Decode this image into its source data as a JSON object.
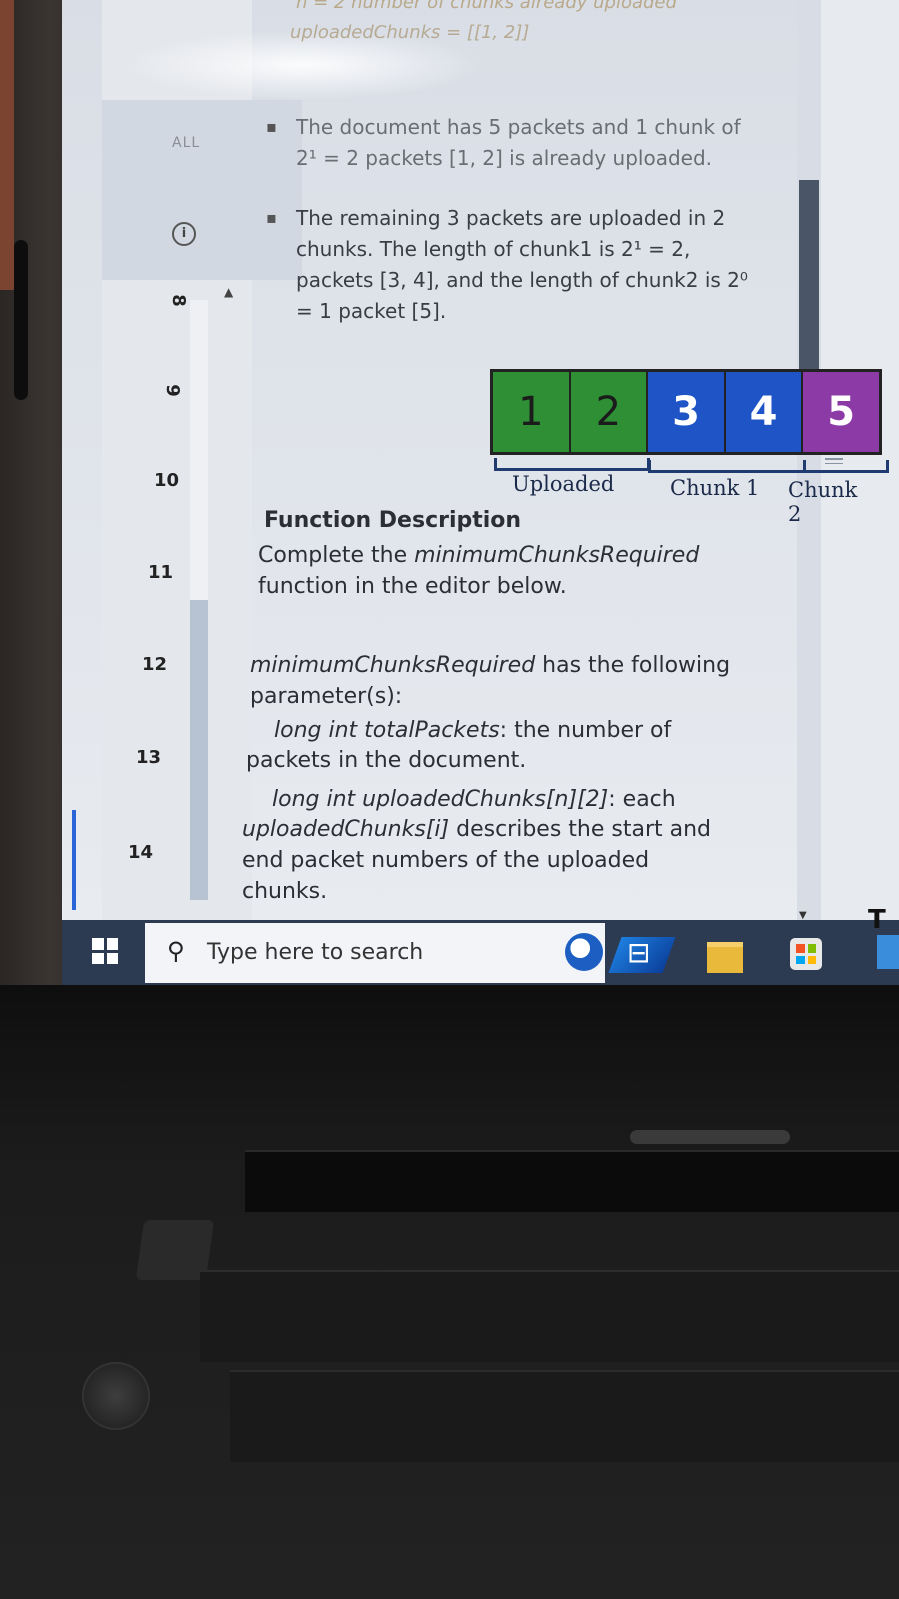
{
  "top_faded": {
    "line1": "n = 2 number of chunks already uploaded",
    "line2": "uploadedChunks = [[1, 2]]"
  },
  "gutter": {
    "all_tab": "ALL",
    "info_icon": "i",
    "line_numbers": [
      "8",
      "9",
      "10",
      "11",
      "12",
      "13",
      "14"
    ]
  },
  "bullets": {
    "b1": "The document has 5 packets and 1 chunk of 2¹ = 2 packets [1, 2] is already uploaded.",
    "b2": "The remaining 3 packets are uploaded in 2 chunks. The length of chunk1 is 2¹ = 2, packets [3, 4], and the length of chunk2 is 2⁰ = 1 packet [5]."
  },
  "diagram": {
    "packets": [
      "1",
      "2",
      "3",
      "4",
      "5"
    ],
    "labels": [
      "Uploaded",
      "Chunk 1",
      "Chunk 2"
    ]
  },
  "description": {
    "heading": "Function Description",
    "line1_pre": "Complete the ",
    "line1_fn": "minimumChunksRequired",
    "line1_post": "function in the editor below.",
    "params_fn": "minimumChunksRequired",
    "params_post": " has the following",
    "params_line2": "parameter(s):",
    "p_total_italic": "long int totalPackets",
    "p_total_rest": ": the number of",
    "p_total_line2": "packets in the document.",
    "p_up_italic": "long int uploadedChunks[n][2]",
    "p_up_rest": ": each",
    "p_up_line2_italic": "uploadedChunks[i]",
    "p_up_line2_rest": " describes the start and",
    "p_up_line3": "end packet numbers of the uploaded",
    "p_up_line4": "chunks."
  },
  "taskbar": {
    "search_placeholder": "Type here to search",
    "right_edge_char": "T"
  },
  "colors": {
    "uploaded": "#2e8f35",
    "chunk1": "#1f54c6",
    "chunk2": "#8c3aa5",
    "taskbar": "#2c3a52"
  }
}
